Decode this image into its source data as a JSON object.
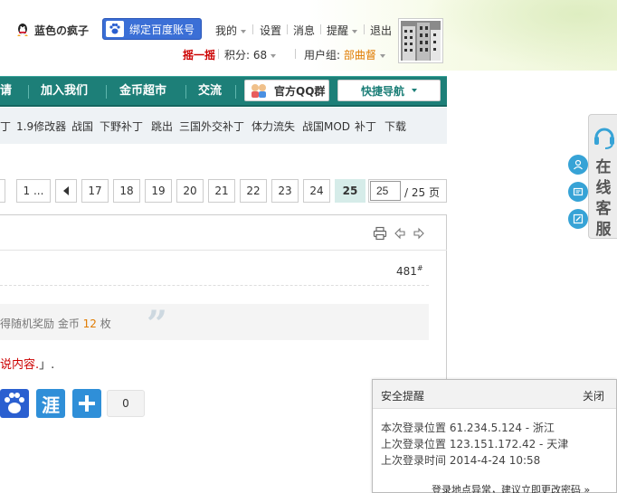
{
  "topbar": {
    "username": "蓝色の疯子",
    "bind_label": "绑定百度账号",
    "my_label": "我的",
    "settings_label": "设置",
    "messages_label": "消息",
    "remind_label": "提醒",
    "logout_label": "退出",
    "shake_label": "摇一摇",
    "points_label": "积分: 68",
    "usergroup_label": "用户组:",
    "usergroup_value": "部曲督"
  },
  "nav": {
    "items": [
      "请",
      "加入我们",
      "金币超市",
      "交流"
    ],
    "qq_label": "官方QQ群",
    "quicknav_label": "快捷导航"
  },
  "subnav": {
    "links": [
      "丁",
      "1.9修改器",
      "战国",
      "下野补丁",
      "跳出",
      "三国外交补丁",
      "体力流失",
      "战国MOD",
      "补丁",
      "下载"
    ]
  },
  "pager": {
    "pages": [
      "1 ...",
      "17",
      "18",
      "19",
      "20",
      "21",
      "22",
      "23",
      "24",
      "25"
    ],
    "current": "25",
    "input_value": "25",
    "total": "/ 25 页"
  },
  "post": {
    "floor": "481",
    "floor_sup": "#",
    "bonus_prefix": "得随机奖励 金币 ",
    "bonus_amount": "12",
    "bonus_suffix": " 枚",
    "quote_mark": "”",
    "body_red": "说内容.",
    "body_rest": "」.",
    "share_count": "0"
  },
  "sidebar": {
    "service_label": "在线客服"
  },
  "security": {
    "title": "安全提醒",
    "close": "关闭",
    "line1": "本次登录位置 61.234.5.124 - 浙江",
    "line2": "上次登录位置 123.151.172.42 - 天津",
    "line3": "上次登录时间 2014-4-24 10:58",
    "link": "登录地点异常，建议立即更改密码 »"
  },
  "colors": {
    "nav_bg": "#1d7f78",
    "accent_red": "#cc0000",
    "accent_orange": "#e07b00",
    "bind_blue": "#3b6fd6",
    "share_baidu": "#2a5fd0",
    "share_blue": "#2f8fd8"
  },
  "icons": [
    "qq-penguin-icon",
    "baidu-paw-icon",
    "print-icon",
    "prev-arrow-icon",
    "next-arrow-icon",
    "headset-icon",
    "user-icon",
    "card-icon",
    "edit-icon"
  ]
}
